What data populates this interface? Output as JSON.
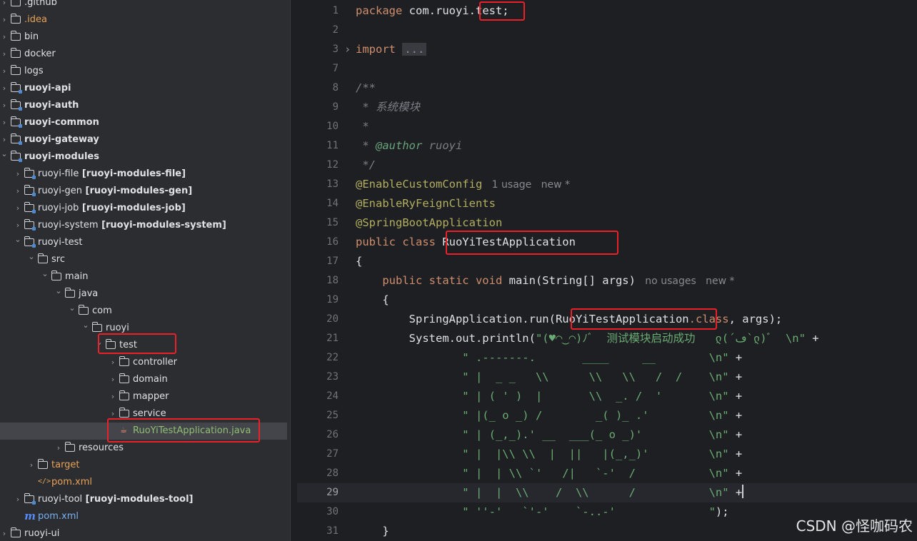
{
  "project_tree": [
    {
      "depth": 0,
      "type": "folder",
      "label": ".github",
      "arrow": "›"
    },
    {
      "depth": 0,
      "type": "folder",
      "label": ".idea",
      "color": "orange",
      "arrow": "›"
    },
    {
      "depth": 0,
      "type": "folder",
      "label": "bin",
      "arrow": "›"
    },
    {
      "depth": 0,
      "type": "folder",
      "label": "docker",
      "arrow": "›"
    },
    {
      "depth": 0,
      "type": "folder",
      "label": "logs",
      "arrow": "›"
    },
    {
      "depth": 0,
      "type": "module",
      "label": "ruoyi-api",
      "bold": true,
      "arrow": "›"
    },
    {
      "depth": 0,
      "type": "module",
      "label": "ruoyi-auth",
      "bold": true,
      "arrow": "›"
    },
    {
      "depth": 0,
      "type": "module",
      "label": "ruoyi-common",
      "bold": true,
      "arrow": "›"
    },
    {
      "depth": 0,
      "type": "module",
      "label": "ruoyi-gateway",
      "bold": true,
      "arrow": "›"
    },
    {
      "depth": 0,
      "type": "module",
      "label": "ruoyi-modules",
      "bold": true,
      "arrow": "⌄"
    },
    {
      "depth": 1,
      "type": "module",
      "label": "ruoyi-file",
      "module": "[ruoyi-modules-file]",
      "arrow": "›"
    },
    {
      "depth": 1,
      "type": "module",
      "label": "ruoyi-gen",
      "module": "[ruoyi-modules-gen]",
      "arrow": "›"
    },
    {
      "depth": 1,
      "type": "module",
      "label": "ruoyi-job",
      "module": "[ruoyi-modules-job]",
      "arrow": "›"
    },
    {
      "depth": 1,
      "type": "module",
      "label": "ruoyi-system",
      "module": "[ruoyi-modules-system]",
      "arrow": "›"
    },
    {
      "depth": 1,
      "type": "module",
      "label": "ruoyi-test",
      "arrow": "⌄"
    },
    {
      "depth": 2,
      "type": "folder",
      "label": "src",
      "arrow": "⌄"
    },
    {
      "depth": 3,
      "type": "folder",
      "label": "main",
      "arrow": "⌄"
    },
    {
      "depth": 4,
      "type": "folder",
      "label": "java",
      "arrow": "⌄"
    },
    {
      "depth": 5,
      "type": "folder",
      "label": "com",
      "arrow": "⌄"
    },
    {
      "depth": 6,
      "type": "folder",
      "label": "ruoyi",
      "arrow": "⌄"
    },
    {
      "depth": 7,
      "type": "folder",
      "label": "test",
      "arrow": "⌄"
    },
    {
      "depth": 8,
      "type": "folder",
      "label": "controller",
      "arrow": "›"
    },
    {
      "depth": 8,
      "type": "folder",
      "label": "domain",
      "arrow": "›"
    },
    {
      "depth": 8,
      "type": "folder",
      "label": "mapper",
      "arrow": "›"
    },
    {
      "depth": 8,
      "type": "folder",
      "label": "service",
      "arrow": "›"
    },
    {
      "depth": 8,
      "type": "java",
      "label": "RuoYiTestApplication.java",
      "color": "green",
      "selected": true,
      "arrow": ""
    },
    {
      "depth": 4,
      "type": "folder",
      "label": "resources",
      "arrow": "›"
    },
    {
      "depth": 2,
      "type": "folder",
      "label": "target",
      "color": "orange",
      "arrow": "›"
    },
    {
      "depth": 2,
      "type": "xml",
      "label": "pom.xml",
      "color": "orange",
      "arrow": ""
    },
    {
      "depth": 1,
      "type": "module",
      "label": "ruoyi-tool",
      "module": "[ruoyi-modules-tool]",
      "arrow": "›"
    },
    {
      "depth": 1,
      "type": "maven",
      "label": "pom.xml",
      "color": "blue",
      "arrow": ""
    },
    {
      "depth": 0,
      "type": "folder",
      "label": "ruoyi-ui",
      "arrow": "›"
    }
  ],
  "icons": {
    "folder": "folder-icon",
    "module": "module-folder-icon",
    "java": "java-class-icon",
    "xml": "xml-file-icon",
    "maven": "maven-pom-icon"
  },
  "colors": {
    "highlight_box": "#e8212a",
    "keyword": "#cf8e6d",
    "annotation": "#b3ae60",
    "string": "#6aab73",
    "comment": "#7a7e85"
  },
  "editor": {
    "current_line": 29,
    "lines": [
      {
        "n": 1,
        "t": [
          {
            "c": "kw",
            "s": "package"
          },
          {
            "s": " com.ruoyi."
          },
          {
            "s": "test;"
          }
        ]
      },
      {
        "n": 2,
        "t": []
      },
      {
        "n": 3,
        "fold": true,
        "t": [
          {
            "c": "kw",
            "s": "import"
          },
          {
            "s": " "
          },
          {
            "c": "ellip",
            "s": "..."
          }
        ]
      },
      {
        "n": 7,
        "t": []
      },
      {
        "n": 8,
        "t": [
          {
            "c": "cm",
            "s": "/**"
          }
        ]
      },
      {
        "n": 9,
        "t": [
          {
            "c": "cm",
            "s": " * 系统模块"
          }
        ]
      },
      {
        "n": 10,
        "t": [
          {
            "c": "cm",
            "s": " *"
          }
        ]
      },
      {
        "n": 11,
        "t": [
          {
            "c": "cm",
            "s": " * "
          },
          {
            "c": "cmtag",
            "s": "@author"
          },
          {
            "c": "cm",
            "s": " ruoyi"
          }
        ]
      },
      {
        "n": 12,
        "t": [
          {
            "c": "cm",
            "s": " */"
          }
        ]
      },
      {
        "n": 13,
        "t": [
          {
            "c": "ann",
            "s": "@EnableCustomConfig"
          },
          {
            "c": "hint",
            "s": "   1 usage   new *"
          }
        ]
      },
      {
        "n": 14,
        "t": [
          {
            "c": "ann",
            "s": "@EnableRyFeignClients"
          }
        ]
      },
      {
        "n": 15,
        "t": [
          {
            "c": "ann",
            "s": "@SpringBootApplication"
          }
        ]
      },
      {
        "n": 16,
        "t": [
          {
            "c": "kw",
            "s": "public class"
          },
          {
            "s": " RuoYiTestApplication"
          }
        ]
      },
      {
        "n": 17,
        "t": [
          {
            "s": "{"
          }
        ]
      },
      {
        "n": 18,
        "t": [
          {
            "s": "    "
          },
          {
            "c": "kw",
            "s": "public static void"
          },
          {
            "s": " main(String[] args)"
          },
          {
            "c": "hint",
            "s": "   no usages   new *"
          }
        ]
      },
      {
        "n": 19,
        "t": [
          {
            "s": "    {"
          }
        ]
      },
      {
        "n": 20,
        "t": [
          {
            "s": "        SpringApplication.run("
          },
          {
            "s": "RuoYiTestApplication"
          },
          {
            "c": "kw",
            "s": ".class"
          },
          {
            "s": ", args);"
          }
        ]
      },
      {
        "n": 21,
        "t": [
          {
            "s": "        System.out.println("
          },
          {
            "c": "str",
            "s": "\"(♥◠‿◠)ﾉﾞ  测试模块启动成功   ლ(´ڡ`ლ)ﾞ  \\n\""
          },
          {
            "s": " +"
          }
        ]
      },
      {
        "n": 22,
        "t": [
          {
            "c": "str",
            "s": "                \" .-------.       ____     __        \\n\""
          },
          {
            "s": " +"
          }
        ]
      },
      {
        "n": 23,
        "t": [
          {
            "c": "str",
            "s": "                \" |  _ _   \\\\      \\\\   \\\\   /  /    \\n\""
          },
          {
            "s": " +"
          }
        ]
      },
      {
        "n": 24,
        "t": [
          {
            "c": "str",
            "s": "                \" | ( ' )  |       \\\\  _. /  '       \\n\""
          },
          {
            "s": " +"
          }
        ]
      },
      {
        "n": 25,
        "t": [
          {
            "c": "str",
            "s": "                \" |(_ o _) /        _( )_ .'         \\n\""
          },
          {
            "s": " +"
          }
        ]
      },
      {
        "n": 26,
        "t": [
          {
            "c": "str",
            "s": "                \" | (_,_).' __  ___(_ o _)'          \\n\""
          },
          {
            "s": " +"
          }
        ]
      },
      {
        "n": 27,
        "t": [
          {
            "c": "str",
            "s": "                \" |  |\\\\ \\\\  |  ||   |(_,_)'         \\n\""
          },
          {
            "s": " +"
          }
        ]
      },
      {
        "n": 28,
        "t": [
          {
            "c": "str",
            "s": "                \" |  | \\\\ `'   /|   `-'  /           \\n\""
          },
          {
            "s": " +"
          }
        ]
      },
      {
        "n": 29,
        "caret": true,
        "t": [
          {
            "c": "str",
            "s": "                \" |  |  \\\\    /  \\\\      /           \\n\""
          },
          {
            "s": " +"
          }
        ]
      },
      {
        "n": 30,
        "t": [
          {
            "c": "str",
            "s": "                \" ''-'   `'-'    `-..-'              \""
          },
          {
            "s": ");"
          }
        ]
      },
      {
        "n": 31,
        "t": [
          {
            "s": "    }"
          }
        ]
      }
    ]
  },
  "watermark": "CSDN @怪咖码农"
}
